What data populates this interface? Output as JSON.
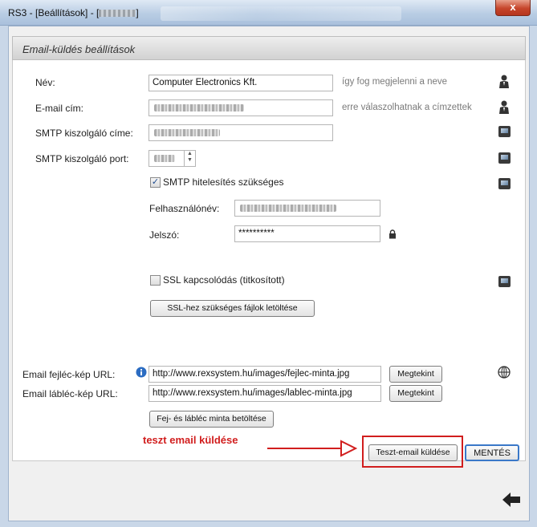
{
  "window": {
    "title": "RS3 - [Beállítások] - [",
    "title_suffix": "]",
    "close_label": "x"
  },
  "panel": {
    "header": "Email-küldés beállítások"
  },
  "form": {
    "name": {
      "label": "Név:",
      "value": "Computer Electronics Kft.",
      "hint": "így fog megjelenni a neve"
    },
    "email": {
      "label": "E-mail cím:",
      "hint": "erre válaszolhatnak a címzettek"
    },
    "smtp_host": {
      "label": "SMTP kiszolgáló címe:"
    },
    "smtp_port": {
      "label": "SMTP kiszolgáló port:"
    },
    "auth_required": {
      "label": "SMTP hitelesítés szükséges",
      "checked": true,
      "check_mark": "✓"
    },
    "username": {
      "label": "Felhasználónév:"
    },
    "password": {
      "label": "Jelszó:",
      "value": "**********"
    },
    "ssl": {
      "label": "SSL kapcsolódás (titkosított)",
      "checked": false
    },
    "ssl_download_button": "SSL-hez szükséges fájlok letöltése",
    "header_image": {
      "label": "Email fejléc-kép URL:",
      "value": "http://www.rexsystem.hu/images/fejlec-minta.jpg",
      "view_button": "Megtekint"
    },
    "footer_image": {
      "label": "Email lábléc-kép URL:",
      "value": "http://www.rexsystem.hu/images/lablec-minta.jpg",
      "view_button": "Megtekint"
    },
    "load_sample_button": "Fej- és lábléc minta betöltése",
    "test_email_button": "Teszt-email küldése",
    "save_button": "MENTÉS"
  },
  "annotation": {
    "text": "teszt email küldése",
    "color": "#d11e1e"
  },
  "icons": {
    "info": "info-icon",
    "globe": "globe-icon",
    "back": "back-arrow-icon",
    "person": "person-icon",
    "monitor": "monitor-icon",
    "lock": "lock-icon"
  }
}
